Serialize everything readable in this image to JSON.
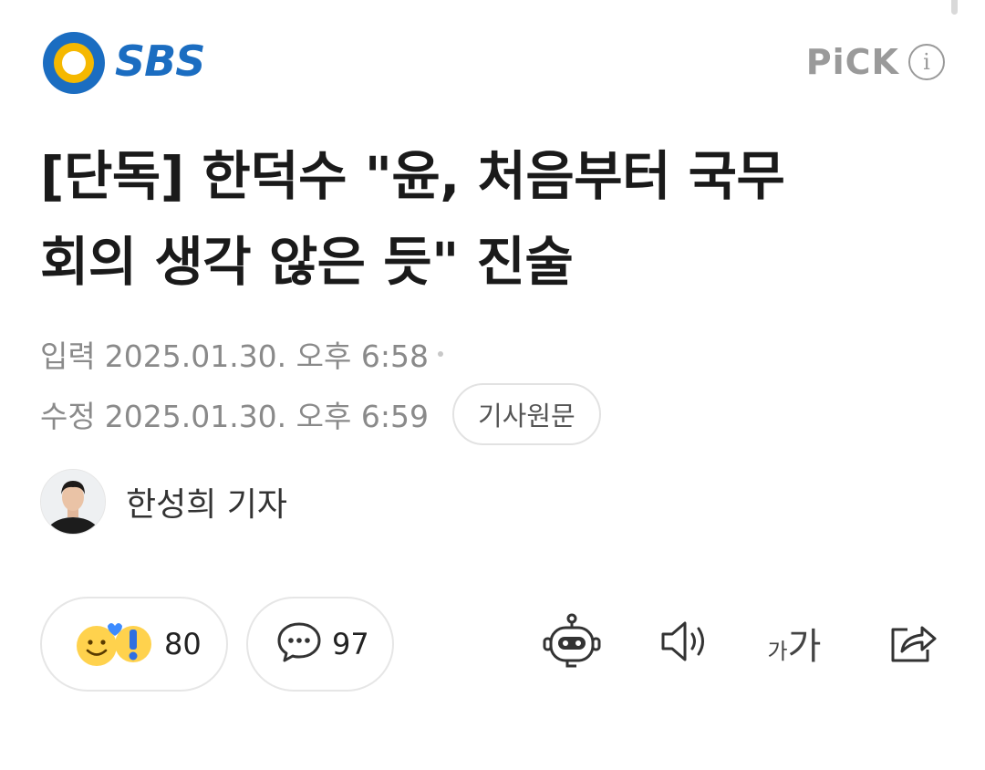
{
  "header": {
    "press_name": "SBS",
    "pick_label": "PiCK",
    "info_icon": "i"
  },
  "article": {
    "title_line1": "[단독] 한덕수 \"윤, 처음부터 국무",
    "title_line2": "회의 생각 않은 듯\" 진술",
    "published_label": "입력",
    "published_value": "2025.01.30. 오후 6:58",
    "modified_label": "수정",
    "modified_value": "2025.01.30. 오후 6:59",
    "original_button": "기사원문",
    "reporter": "한성희 기자"
  },
  "actions": {
    "reactions_count": "80",
    "comments_count": "97",
    "font_size_small": "가",
    "font_size_large": "가"
  },
  "icons": [
    "sbs-logo-icon",
    "info-icon",
    "reaction-icon",
    "comment-icon",
    "ai-bot-icon",
    "speaker-icon",
    "font-size-icon",
    "share-icon"
  ],
  "colors": {
    "brand_blue": "#1b6dc1",
    "brand_yellow": "#f5b800",
    "muted_gray": "#8a8a8a"
  }
}
